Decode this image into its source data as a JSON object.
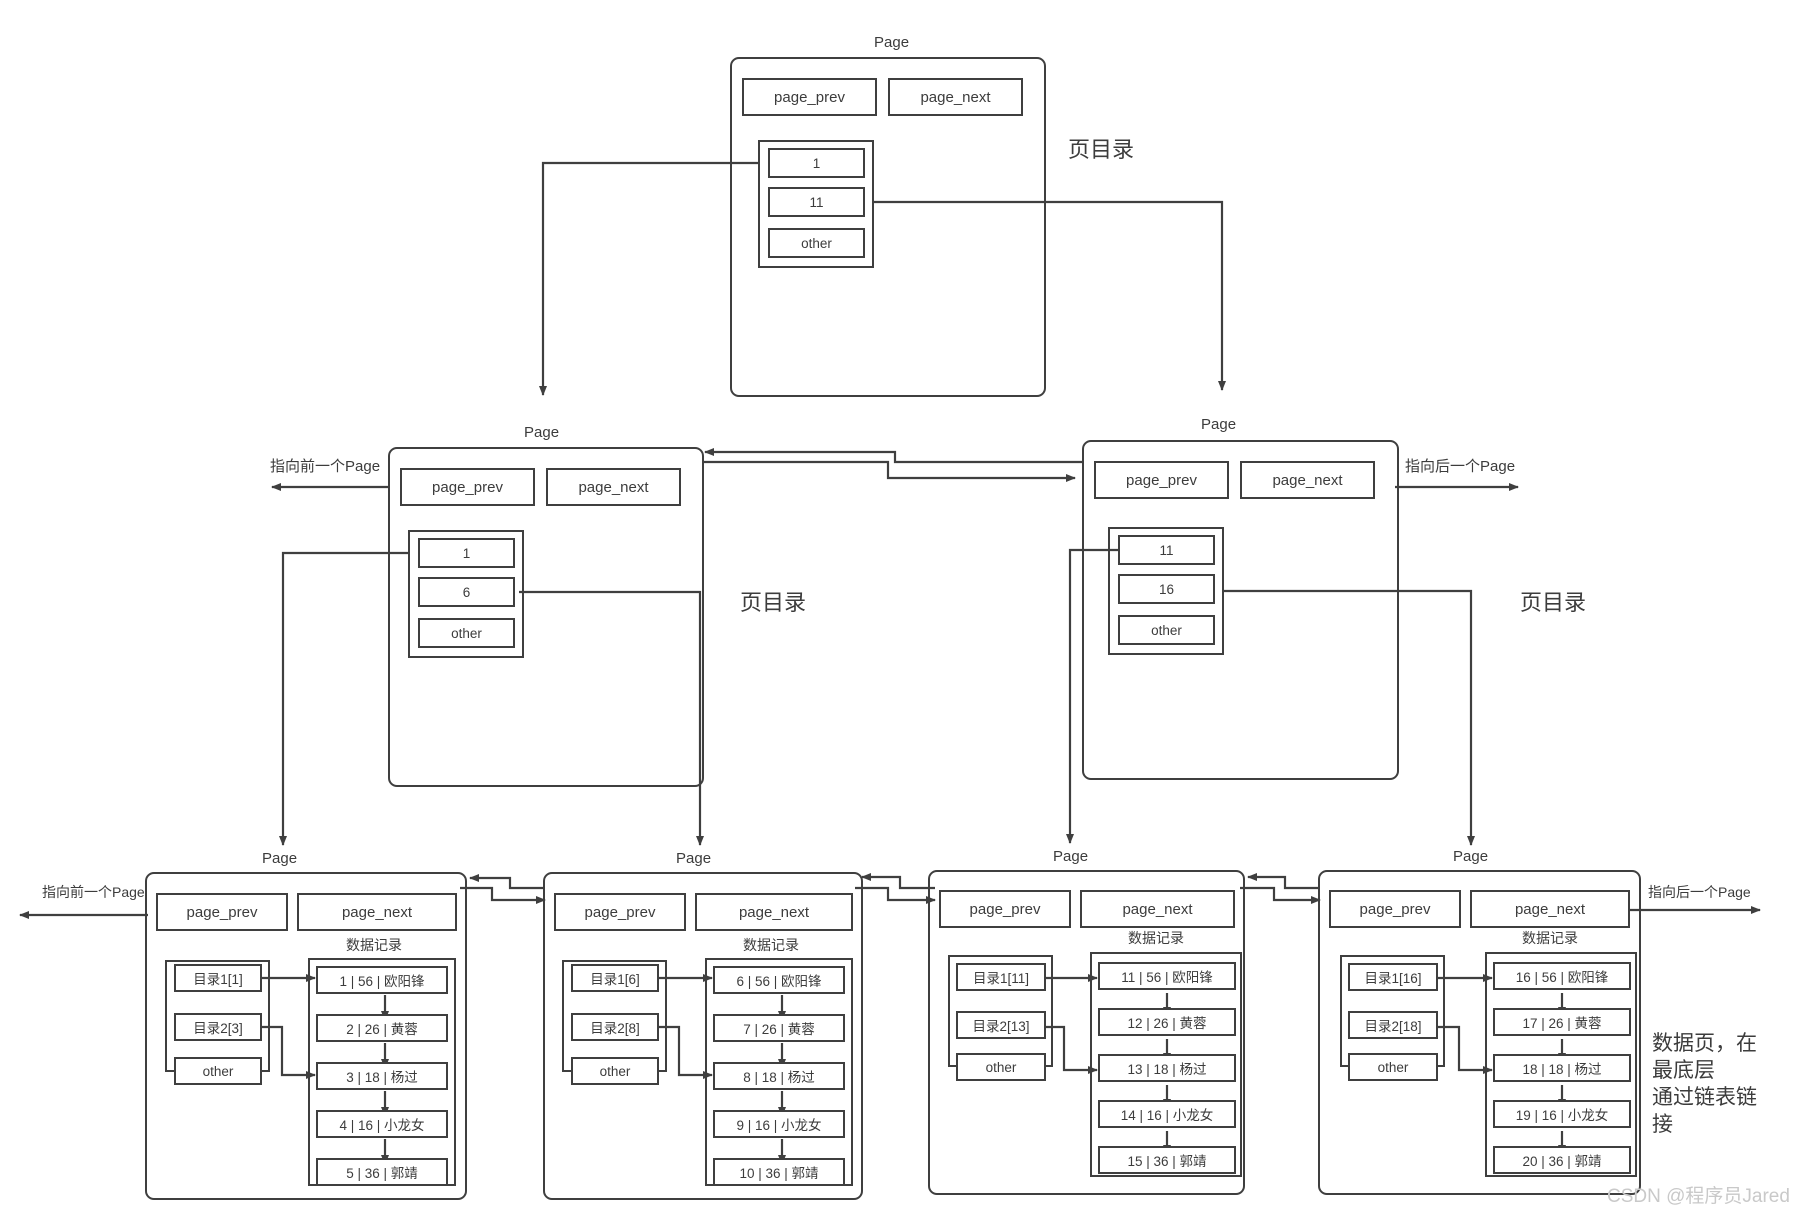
{
  "diagram": {
    "title_labels": {
      "page": "Page",
      "page_prev": "page_prev",
      "page_next": "page_next",
      "other": "other",
      "page_directory": "页目录",
      "data_records": "数据记录",
      "prev_page_arrow": "指向前一个Page",
      "next_page_arrow": "指向后一个Page",
      "bottom_note": "数据页，在最底层 通过链表链接"
    },
    "watermark": "CSDN @程序员Jared",
    "root": {
      "caption": "Page",
      "page_prev": "page_prev",
      "page_next": "page_next",
      "directory_label": "页目录",
      "entries": [
        "1",
        "11",
        "other"
      ]
    },
    "level2": [
      {
        "caption": "Page",
        "page_prev": "page_prev",
        "page_next": "page_next",
        "directory_label": "页目录",
        "entries": [
          "1",
          "6",
          "other"
        ],
        "prev_arrow_label": "指向前一个Page"
      },
      {
        "caption": "Page",
        "page_prev": "page_prev",
        "page_next": "page_next",
        "directory_label": "页目录",
        "entries": [
          "11",
          "16",
          "other"
        ],
        "next_arrow_label": "指向后一个Page"
      }
    ],
    "leaves": [
      {
        "caption": "Page",
        "page_prev": "page_prev",
        "page_next": "page_next",
        "records_label": "数据记录",
        "dir_entries": [
          "目录1[1]",
          "目录2[3]",
          "other"
        ],
        "records": [
          "1 | 56 | 欧阳锋",
          "2 | 26 | 黄蓉",
          "3 | 18 | 杨过",
          "4 | 16 | 小龙女",
          "5 | 36 | 郭靖"
        ],
        "prev_arrow_label": "指向前一个Page"
      },
      {
        "caption": "Page",
        "page_prev": "page_prev",
        "page_next": "page_next",
        "records_label": "数据记录",
        "dir_entries": [
          "目录1[6]",
          "目录2[8]",
          "other"
        ],
        "records": [
          "6 | 56 | 欧阳锋",
          "7 | 26 | 黄蓉",
          "8 | 18 | 杨过",
          "9 | 16 | 小龙女",
          "10 | 36 | 郭靖"
        ]
      },
      {
        "caption": "Page",
        "page_prev": "page_prev",
        "page_next": "page_next",
        "records_label": "数据记录",
        "dir_entries": [
          "目录1[11]",
          "目录2[13]",
          "other"
        ],
        "records": [
          "11 | 56 | 欧阳锋",
          "12 | 26 | 黄蓉",
          "13 | 18 | 杨过",
          "14 | 16 | 小龙女",
          "15 | 36 | 郭靖"
        ]
      },
      {
        "caption": "Page",
        "page_prev": "page_prev",
        "page_next": "page_next",
        "records_label": "数据记录",
        "dir_entries": [
          "目录1[16]",
          "目录2[18]",
          "other"
        ],
        "records": [
          "16 | 56 | 欧阳锋",
          "17 | 26 | 黄蓉",
          "18 | 18 | 杨过",
          "19 | 16 | 小龙女",
          "20 | 36 | 郭靖"
        ],
        "next_arrow_label": "指向后一个Page"
      }
    ],
    "bottom_note_lines": [
      "数据页，在",
      "最底层",
      "通过链表链",
      "接"
    ],
    "colors": {
      "stroke": "#3f3f3f",
      "text": "#3c3c3c",
      "background": "#ffffff",
      "watermark": "#c9c9c9"
    }
  }
}
